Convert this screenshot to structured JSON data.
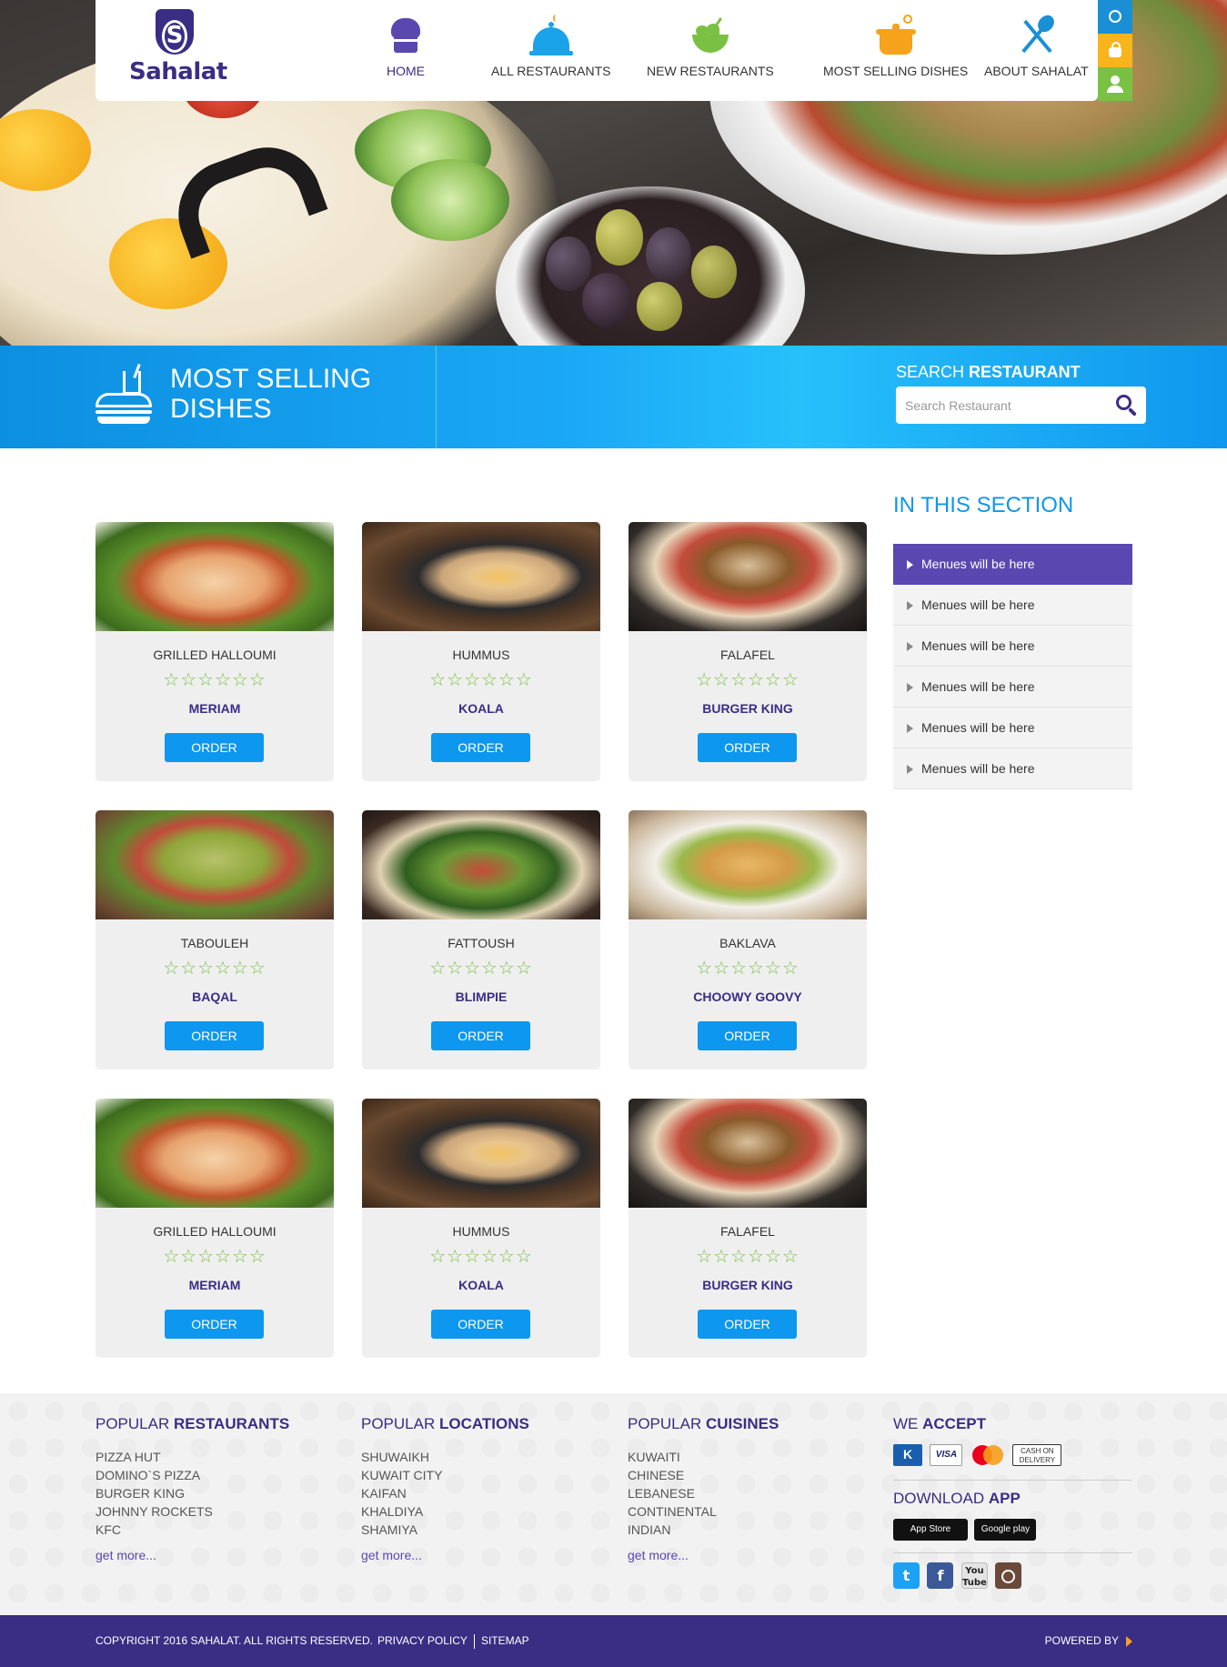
{
  "brand": {
    "name": "Sahalat"
  },
  "nav": [
    {
      "label": "HOME",
      "icon": "chef-hat-icon",
      "active": true
    },
    {
      "label": "ALL RESTAURANTS",
      "icon": "cloche-icon"
    },
    {
      "label": "NEW RESTAURANTS",
      "icon": "salad-bowl-icon"
    },
    {
      "label": "MOST SELLING DISHES",
      "icon": "cooking-pot-icon"
    },
    {
      "label": "ABOUT SAHALAT",
      "icon": "cutlery-icon"
    }
  ],
  "utility": [
    {
      "icon": "globe-icon",
      "color": "#1a8fd6"
    },
    {
      "icon": "lock-icon",
      "color": "#f7b51b"
    },
    {
      "icon": "user-icon",
      "color": "#7ac143"
    }
  ],
  "section": {
    "title_line1": "MOST SELLING",
    "title_line2": "DISHES",
    "search_label_prefix": "SEARCH ",
    "search_label_bold": "RESTAURANT",
    "search_placeholder": "Search Restaurant"
  },
  "dishes": [
    {
      "name": "GRILLED HALLOUMI",
      "restaurant": "MERIAM",
      "stars": "☆☆☆☆☆☆",
      "order": "ORDER"
    },
    {
      "name": "HUMMUS",
      "restaurant": "KOALA",
      "stars": "☆☆☆☆☆☆",
      "order": "ORDER"
    },
    {
      "name": "FALAFEL",
      "restaurant": "BURGER KING",
      "stars": "☆☆☆☆☆☆",
      "order": "ORDER"
    },
    {
      "name": "TABOULEH",
      "restaurant": "BAQAL",
      "stars": "☆☆☆☆☆☆",
      "order": "ORDER"
    },
    {
      "name": "FATTOUSH",
      "restaurant": "BLIMPIE",
      "stars": "☆☆☆☆☆☆",
      "order": "ORDER"
    },
    {
      "name": "BAKLAVA",
      "restaurant": "CHOOWY GOOVY",
      "stars": "☆☆☆☆☆☆",
      "order": "ORDER"
    },
    {
      "name": "GRILLED HALLOUMI",
      "restaurant": "MERIAM",
      "stars": "☆☆☆☆☆☆",
      "order": "ORDER"
    },
    {
      "name": "HUMMUS",
      "restaurant": "KOALA",
      "stars": "☆☆☆☆☆☆",
      "order": "ORDER"
    },
    {
      "name": "FALAFEL",
      "restaurant": "BURGER KING",
      "stars": "☆☆☆☆☆☆",
      "order": "ORDER"
    }
  ],
  "sidebar": {
    "title": "IN THIS SECTION",
    "items": [
      {
        "label": "Menues will be here",
        "active": true
      },
      {
        "label": "Menues will be here"
      },
      {
        "label": "Menues will be here"
      },
      {
        "label": "Menues will be here"
      },
      {
        "label": "Menues will be here"
      },
      {
        "label": "Menues will be here"
      }
    ]
  },
  "footer": {
    "restaurants": {
      "prefix": "POPULAR ",
      "bold": "RESTAURANTS",
      "items": [
        "PIZZA HUT",
        "DOMINO`S PIZZA",
        "BURGER KING",
        "JOHNNY ROCKETS",
        "KFC"
      ],
      "more": "get more..."
    },
    "locations": {
      "prefix": "POPULAR ",
      "bold": "LOCATIONS",
      "items": [
        "SHUWAIKH",
        "KUWAIT CITY",
        "KAIFAN",
        "KHALDIYA",
        "SHAMIYA"
      ],
      "more": "get more..."
    },
    "cuisines": {
      "prefix": "POPULAR ",
      "bold": "CUISINES",
      "items": [
        "KUWAITI",
        "CHINESE",
        "LEBANESE",
        "CONTINENTAL",
        "INDIAN"
      ],
      "more": "get more..."
    },
    "accept": {
      "prefix": "WE ",
      "bold": "ACCEPT",
      "cod_line1": "CASH ON",
      "cod_line2": "DELIVERY"
    },
    "app": {
      "prefix": "DOWNLOAD ",
      "bold": "APP",
      "appstore": "App Store",
      "googleplay": "Google play"
    },
    "social": {
      "youtube_line1": "You",
      "youtube_line2": "Tube"
    }
  },
  "bottom": {
    "copyright": "COPYRIGHT 2016 SAHALAT. ALL RIGHTS RESERVED.",
    "privacy": "PRIVACY POLICY",
    "sitemap": "SITEMAP",
    "powered": "POWERED BY"
  }
}
